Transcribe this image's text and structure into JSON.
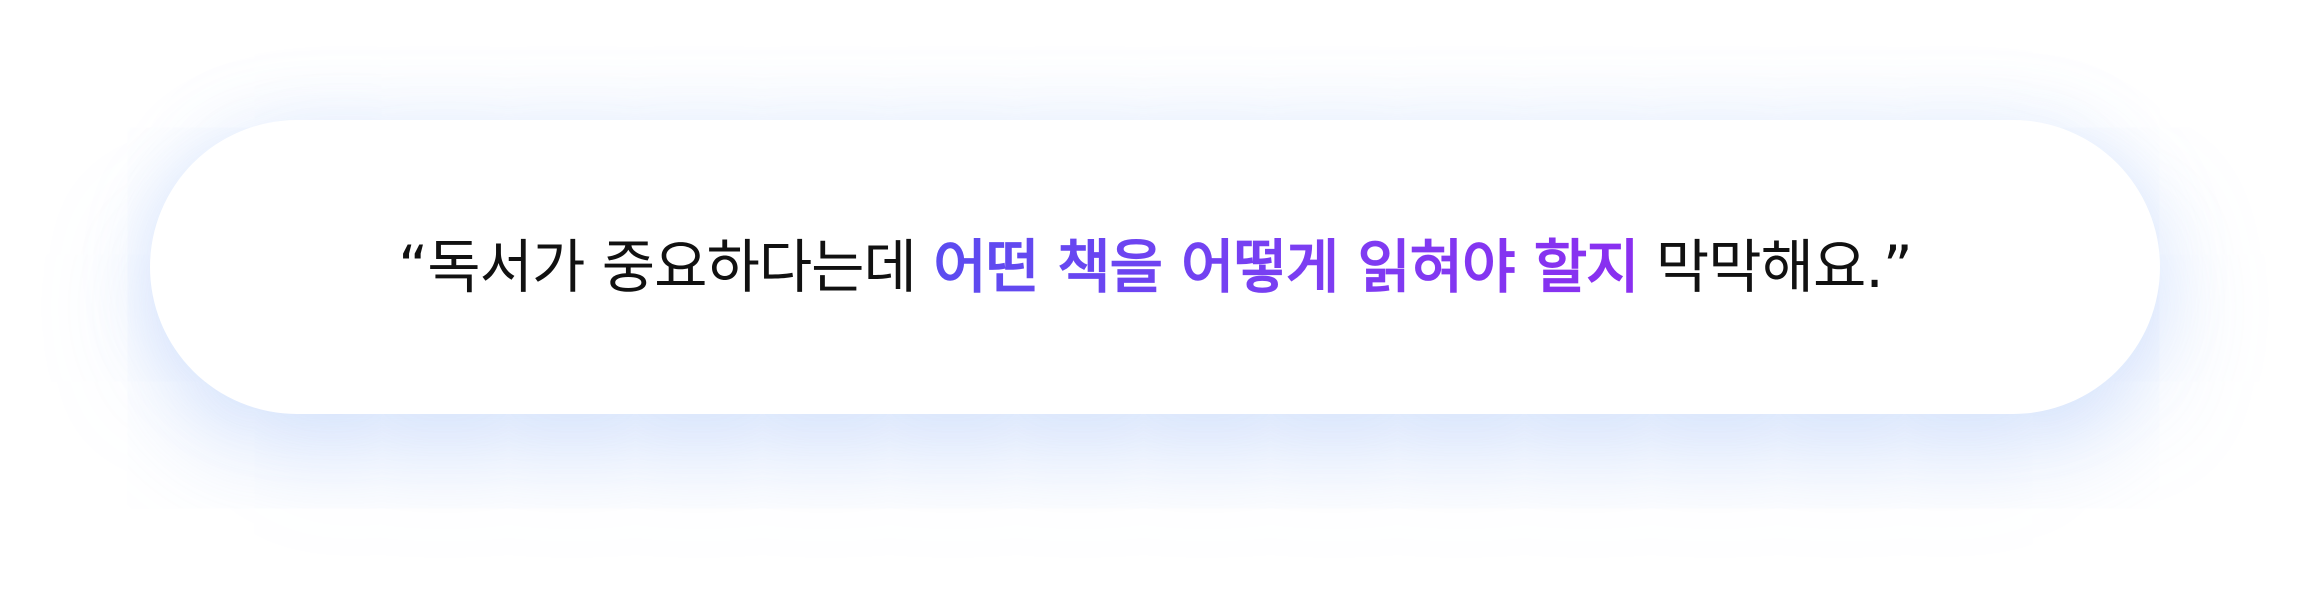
{
  "quote": {
    "open_mark": "“",
    "before": "독서가 중요하다는데 ",
    "highlight": "어떤 책을 어떻게 읽혀야 할지",
    "after": " 막막해요.",
    "close_mark": "”"
  },
  "colors": {
    "text": "#111111",
    "highlight_start": "#5b4cf0",
    "highlight_end": "#8a2ff0",
    "glow": "#78a0f5"
  }
}
